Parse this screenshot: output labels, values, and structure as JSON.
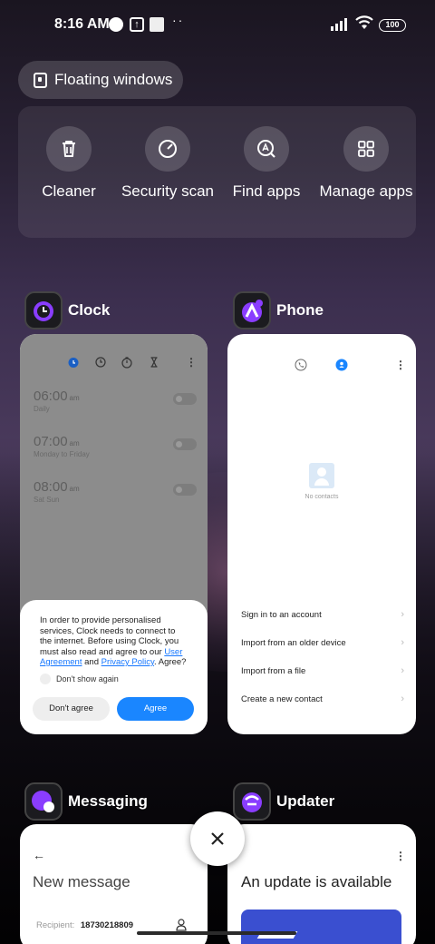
{
  "status_bar": {
    "time": "8:16 AM",
    "dots": "··",
    "battery": "100"
  },
  "floating_windows": {
    "label": "Floating windows"
  },
  "tools": [
    {
      "label": "Cleaner",
      "icon": "trash-icon"
    },
    {
      "label": "Security scan",
      "icon": "security-scan-icon"
    },
    {
      "label": "Find apps",
      "icon": "find-apps-icon"
    },
    {
      "label": "Manage apps",
      "icon": "manage-apps-icon"
    }
  ],
  "apps": {
    "clock": {
      "title": "Clock",
      "alarms": [
        {
          "time": "06:00",
          "ampm": "am",
          "repeat": "Daily"
        },
        {
          "time": "07:00",
          "ampm": "am",
          "repeat": "Monday to Friday"
        },
        {
          "time": "08:00",
          "ampm": "am",
          "repeat": "Sat Sun"
        }
      ],
      "consent": {
        "text_part1": "In order to provide personalised services, Clock needs to connect to the internet. Before using Clock, you must also read and agree to our ",
        "link_user_agreement": "User Agreement",
        "text_and": " and ",
        "link_privacy": "Privacy Policy",
        "text_end": ". Agree?",
        "dont_show": "Don't show again",
        "disagree": "Don't agree",
        "agree": "Agree"
      }
    },
    "phone": {
      "title": "Phone",
      "empty_text": "No contacts",
      "options": [
        "Sign in to an account",
        "Import from an older device",
        "Import from a file",
        "Create a new contact"
      ]
    },
    "messaging": {
      "title": "Messaging",
      "screen_title": "New message",
      "recipient_label": "Recipient:",
      "recipient_value": "18730218809"
    },
    "updater": {
      "title": "Updater",
      "screen_title": "An update is available"
    }
  },
  "colors": {
    "accent_blue": "#1a86ff",
    "link_blue": "#1677ff"
  }
}
